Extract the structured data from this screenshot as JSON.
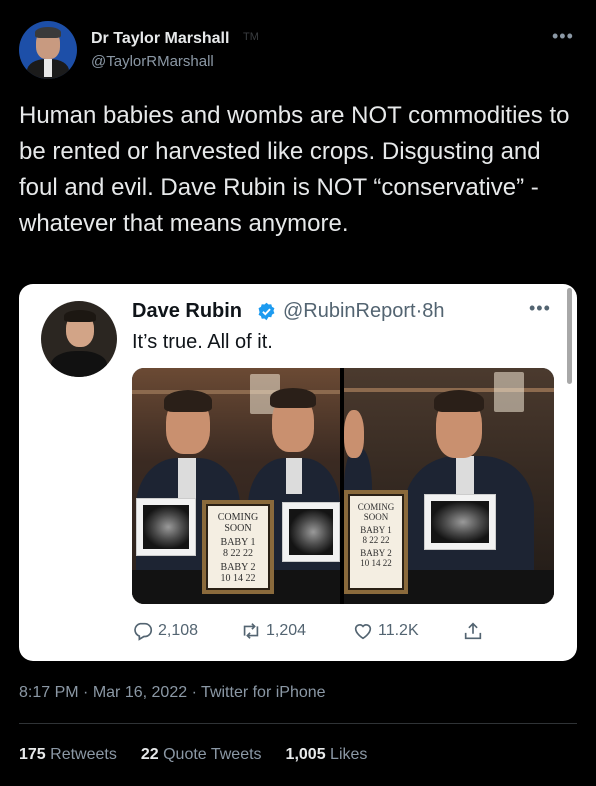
{
  "author": {
    "name": "Dr Taylor Marshall",
    "mark": "TM",
    "handle": "@TaylorRMarshall"
  },
  "tweet": {
    "text": "Human babies and wombs are NOT commodities to be rented or harvested like crops. Disgusting and foul and evil. Dave Rubin is NOT “conservative” - whatever that means anymore."
  },
  "quoted": {
    "name": "Dave Rubin",
    "handle": "@RubinReport",
    "separator": "·",
    "age": "8h",
    "text": "It’s true. All of it.",
    "photo_left": {
      "sign_lines": [
        "COMING",
        "SOON",
        "BABY 1",
        "8 22 22",
        "BABY 2",
        "10 14 22"
      ]
    },
    "photo_right": {
      "sign_lines": [
        "COMING",
        "SOON",
        "BABY 1",
        "8 22 22",
        "BABY 2",
        "10 14 22"
      ]
    },
    "actions": {
      "replies": "2,108",
      "retweets": "1,204",
      "likes": "11.2K"
    }
  },
  "meta": {
    "time": "8:17 PM",
    "dot1": "·",
    "date": "Mar 16, 2022",
    "dot2": "·",
    "source": "Twitter for iPhone"
  },
  "stats": {
    "retweets_count": "175",
    "retweets_label": "Retweets",
    "quotes_count": "22",
    "quotes_label": "Quote Tweets",
    "likes_count": "1,005",
    "likes_label": "Likes"
  },
  "colors": {
    "background": "#000000",
    "text": "#e7e9ea",
    "muted": "#8b98a5",
    "verified": "#1d9bf0"
  }
}
